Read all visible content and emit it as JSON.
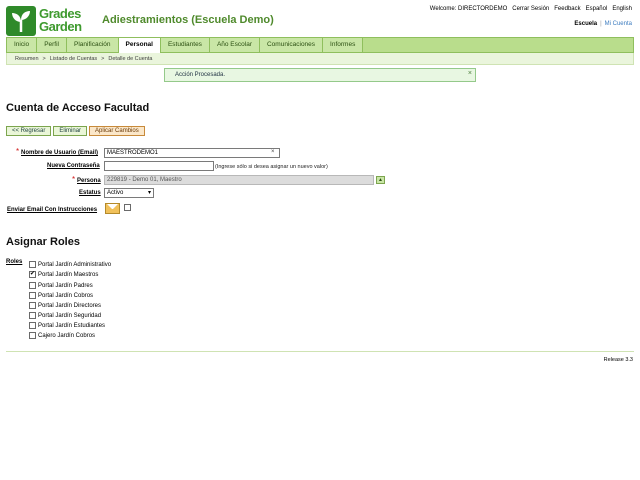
{
  "logo": {
    "line1": "Grades",
    "line2": "Garden"
  },
  "app_title": "Adiestramientos (Escuela Demo)",
  "top_links": {
    "welcome": "Welcome: DIRECTORDEMO",
    "logout": "Cerrar Sesión",
    "feedback": "Feedback",
    "spanish": "Español",
    "english": "English"
  },
  "school_links": {
    "school": "Escuela",
    "separator": "|",
    "account": "Mi Cuenta"
  },
  "nav": {
    "tabs": [
      {
        "label": "Inicio"
      },
      {
        "label": "Perfil"
      },
      {
        "label": "Planificación"
      },
      {
        "label": "Personal"
      },
      {
        "label": "Estudiantes"
      },
      {
        "label": "Año Escolar"
      },
      {
        "label": "Comunicaciones"
      },
      {
        "label": "Informes"
      }
    ]
  },
  "breadcrumb": {
    "items": [
      "Resumen",
      "Listado de Cuentas",
      "Detalle de Cuenta"
    ],
    "separator": ">"
  },
  "alert": {
    "message": "Acción Procesada.",
    "close": "×"
  },
  "page_title": "Cuenta de Acceso Facultad",
  "buttons": {
    "back": "<< Regresar",
    "delete": "Eliminar",
    "apply": "Aplicar Cambios"
  },
  "form": {
    "username": {
      "label": "Nombre de Usuario (Email)",
      "value": "MAESTRODEMO1",
      "clear": "×"
    },
    "password": {
      "label": "Nueva Contraseña",
      "value": "",
      "hint": "(Ingrese sólo si desea asignar un nuevo valor)"
    },
    "person": {
      "label": "Persona",
      "value": "229819 - Demo 01, Maestro"
    },
    "status": {
      "label": "Estatus",
      "value": "Activo"
    },
    "email_instructions": {
      "label": "Enviar Email Con Instrucciones"
    }
  },
  "required_mark": "*",
  "roles_title": "Asignar Roles",
  "roles_label": "Roles",
  "roles": [
    {
      "label": "Portal Jardín Administrativo",
      "checked": false
    },
    {
      "label": "Portal Jardín Maestros",
      "checked": true
    },
    {
      "label": "Portal Jardín Padres",
      "checked": false
    },
    {
      "label": "Portal Jardín Cobros",
      "checked": false
    },
    {
      "label": "Portal Jardín Directores",
      "checked": false
    },
    {
      "label": "Portal Jardín Seguridad",
      "checked": false
    },
    {
      "label": "Portal Jardín Estudiantes",
      "checked": false
    },
    {
      "label": "Cajero Jardín Cobros",
      "checked": false
    }
  ],
  "check_mark": "✔",
  "release": "Release 3.3",
  "colors": {
    "brand_green": "#3e9a2e",
    "nav_bg": "#b9dd8c",
    "alert_bg": "#e8f7e2"
  }
}
